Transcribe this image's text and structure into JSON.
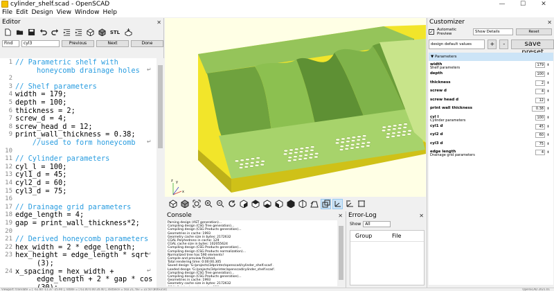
{
  "window": {
    "title": "cylinder_shelf.scad - OpenSCAD",
    "controls": [
      "—",
      "☐",
      "✕"
    ]
  },
  "menu": [
    "File",
    "Edit",
    "Design",
    "View",
    "Window",
    "Help"
  ],
  "editor": {
    "title": "Editor",
    "find": {
      "mode": "Find",
      "query": "cyl3",
      "previous_label": "Previous",
      "next_label": "Next",
      "done_label": "Done"
    },
    "lines": [
      {
        "n": "1",
        "text": "// Parametric shelf with",
        "type": "comment"
      },
      {
        "n": "",
        "text": "     honeycomb drainage holes",
        "type": "comment"
      },
      {
        "n": "2",
        "text": "",
        "type": "code"
      },
      {
        "n": "3",
        "text": "// Shelf parameters",
        "type": "comment"
      },
      {
        "n": "4",
        "text": "width = 179;",
        "type": "code"
      },
      {
        "n": "5",
        "text": "depth = 100;",
        "type": "code"
      },
      {
        "n": "6",
        "text": "thickness = 2;",
        "type": "code"
      },
      {
        "n": "7",
        "text": "screw_d = 4;",
        "type": "code"
      },
      {
        "n": "8",
        "text": "screw_head_d = 12;",
        "type": "code"
      },
      {
        "n": "9",
        "text": "print_wall_thickness = 0.38;",
        "type": "code"
      },
      {
        "n": "",
        "text": "    //used to form honeycomb",
        "type": "comment"
      },
      {
        "n": "10",
        "text": "",
        "type": "code"
      },
      {
        "n": "11",
        "text": "// Cylinder parameters",
        "type": "comment"
      },
      {
        "n": "12",
        "text": "cyl_l = 100;",
        "type": "code"
      },
      {
        "n": "13",
        "text": "cyl1_d = 45;",
        "type": "code"
      },
      {
        "n": "14",
        "text": "cyl2_d = 60;",
        "type": "code"
      },
      {
        "n": "15",
        "text": "cyl3_d = 75;",
        "type": "code"
      },
      {
        "n": "16",
        "text": "",
        "type": "code"
      },
      {
        "n": "17",
        "text": "// Drainage grid parameters",
        "type": "comment"
      },
      {
        "n": "18",
        "text": "edge_length = 4;",
        "type": "code"
      },
      {
        "n": "19",
        "text": "gap = print_wall_thickness*2;",
        "type": "code"
      },
      {
        "n": "20",
        "text": "",
        "type": "code"
      },
      {
        "n": "21",
        "text": "// Derived honeycomb parameters",
        "type": "comment"
      },
      {
        "n": "22",
        "text": "hex_width = 2 * edge_length;",
        "type": "code"
      },
      {
        "n": "23",
        "text": "hex_height = edge_length * sqrt",
        "type": "code"
      },
      {
        "n": "",
        "text": "     (3);",
        "type": "code"
      },
      {
        "n": "24",
        "text": "x_spacing = hex_width +",
        "type": "code"
      },
      {
        "n": "",
        "text": "     edge_length + 2 * gap * cos",
        "type": "code"
      },
      {
        "n": "",
        "text": "     (30);",
        "type": "code"
      }
    ]
  },
  "viewport": {
    "colors": {
      "background": "#ffffe5",
      "top_face": "#f2e52a",
      "front_face": "#d8cc1a",
      "model_light": "#a7d36b",
      "model_mid": "#7fb34a",
      "model_dark": "#4e7f2c"
    },
    "axis_labels": [
      "y",
      "z",
      "x"
    ]
  },
  "view_toolbar": {
    "icons": [
      "preview-icon",
      "render-icon",
      "view-all-icon",
      "zoom-in-icon",
      "zoom-out-icon",
      "reset-view-icon",
      "view-right-icon",
      "view-top-icon",
      "view-bottom-icon",
      "view-left-icon",
      "view-front-icon",
      "view-back-icon",
      "perspective-icon",
      "orthogonal-icon",
      "show-axes-icon",
      "show-scale-icon",
      "show-edges-icon"
    ]
  },
  "console": {
    "title": "Console",
    "lines": [
      "Parsing design (AST generation)...",
      "Compiling design (CSG Tree generation)...",
      "Compiling design (CSG Products generation)...",
      "Geometries in cache: 1993",
      "Geometry cache size in bytes: 2172632",
      "CGAL Polyhedrons in cache: 129",
      "CGAL cache size in bytes: 102055624",
      "Compiling design (CSG Products generation)...",
      "Compiling design (CSG Products normalization)...",
      "Normalized tree has 590 elements!",
      "Compile and preview finished.",
      "Total rendering time: 0:00:00.305",
      "Saved design 'G:/projects/3dprinter/openscad/cylinder_shelf.scad'.",
      "Loaded design 'G:/projects/3dprinter/openscad/cylinder_shelf.scad'.",
      "Compiling design (CSG Tree generation)...",
      "Compiling design (CSG Products generation)...",
      "Geometries in cache: 1993",
      "Geometry cache size in bytes: 2172632",
      "CGAL Polyhedrons in cache: 129"
    ]
  },
  "error_log": {
    "title": "Error-Log",
    "show_label": "Show",
    "show_value": "All",
    "columns": [
      "Group",
      "File"
    ]
  },
  "customizer": {
    "title": "Customizer",
    "automatic_preview_label": "Automatic Preview",
    "automatic_preview_checked": "✓",
    "show_details_value": "Show Details",
    "reset_label": "Reset",
    "preset_value": "design default values",
    "plus_label": "+",
    "minus_label": "-",
    "save_preset_label": "save preset",
    "group_label": "Parameters",
    "params": [
      {
        "name": "width",
        "desc": "Shelf parameters",
        "value": "179"
      },
      {
        "name": "depth",
        "desc": "",
        "value": "100"
      },
      {
        "name": "thickness",
        "desc": "",
        "value": "2"
      },
      {
        "name": "screw d",
        "desc": "",
        "value": "4"
      },
      {
        "name": "screw head d",
        "desc": "",
        "value": "12"
      },
      {
        "name": "print wall thickness",
        "desc": "",
        "value": "0.38"
      },
      {
        "name": "cyl l",
        "desc": "Cylinder parameters",
        "value": "100"
      },
      {
        "name": "cyl1 d",
        "desc": "",
        "value": "45"
      },
      {
        "name": "cyl2 d",
        "desc": "",
        "value": "60"
      },
      {
        "name": "cyl3 d",
        "desc": "",
        "value": "75"
      },
      {
        "name": "edge length",
        "desc": "Drainage grid parameters",
        "value": "4"
      }
    ]
  },
  "statusbar": {
    "left": "Viewport: translate = [ -61.60 -11.37 -25.90 ], rotate = [ 61.00 0.00 20.40 ], distance = 502.21, fov = 22.50 (800x354)",
    "right": "OpenSCAD 2021.01"
  }
}
